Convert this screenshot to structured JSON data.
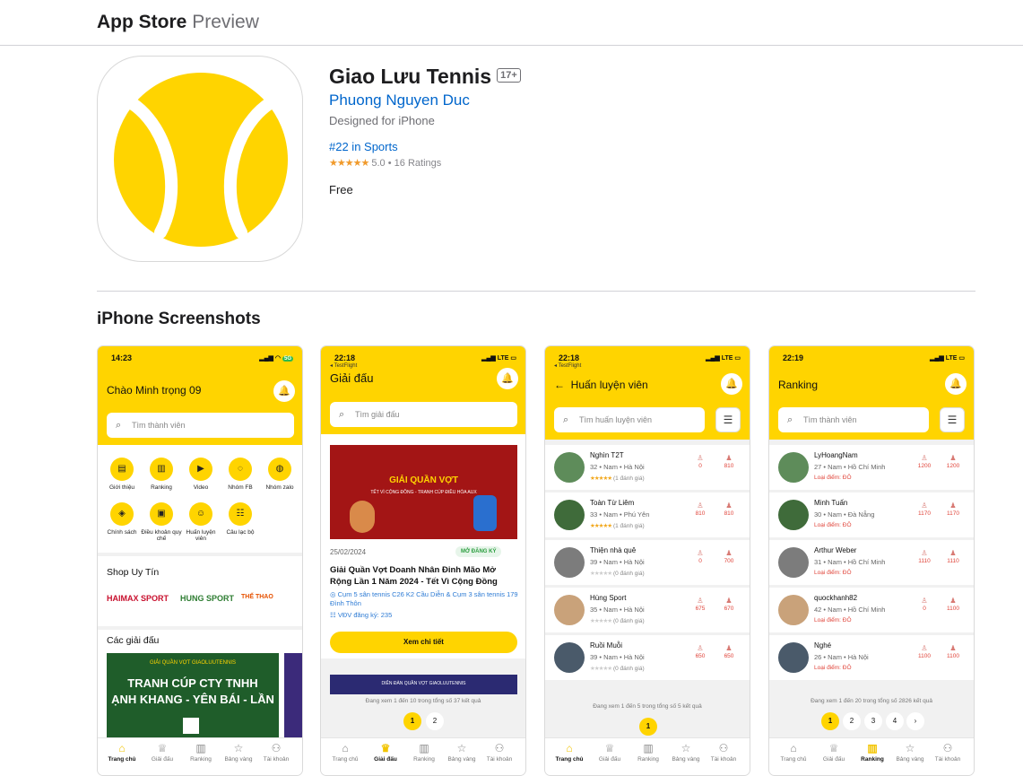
{
  "header": {
    "brand": "App Store",
    "brand_suffix": "Preview"
  },
  "app": {
    "title": "Giao Lưu Tennis",
    "age_rating": "17+",
    "developer": "Phuong Nguyen Duc",
    "designed_for": "Designed for iPhone",
    "rank": "#22 in Sports",
    "stars": "★★★★★",
    "rating_value": "5.0",
    "rating_sep": "•",
    "rating_count": "16 Ratings",
    "price": "Free",
    "icon_color": "#ffd400"
  },
  "screenshots_title": "iPhone Screenshots",
  "tabs": [
    "Trang chủ",
    "Giải đấu",
    "Ranking",
    "Bảng vàng",
    "Tài khoản"
  ],
  "screen1": {
    "time": "14:23",
    "greeting": "Chào Minh trọng 09",
    "search_placeholder": "Tìm thành viên",
    "quick_actions": [
      "Giới thiệu",
      "Ranking",
      "Video",
      "Nhóm FB",
      "Nhóm zalo",
      "Chính sách",
      "Điều khoản quy chế",
      "Huấn luyện viên",
      "Câu lạc bộ"
    ],
    "shop_title": "Shop Uy Tín",
    "sponsors": [
      "HAIMAX SPORT",
      "HUNG SPORT",
      "THẾ THAO"
    ],
    "tournaments_title": "Các giải đấu",
    "banner_top": "GIẢI QUẦN VỢT GIAOLUUTENNIS",
    "banner_line1": "TRANH CÚP CTY TNHH",
    "banner_line2": "ẠNH KHANG - YÊN BÁI - LẦN",
    "network": "5G"
  },
  "screen2": {
    "time": "22:18",
    "testflight": "◂ TestFlight",
    "title": "Giải đấu",
    "search_placeholder": "Tìm giải đấu",
    "banner_title": "GIẢI QUẦN VỢT",
    "banner_sub": "TẾT VÌ CỘNG ĐỒNG - TRANH CÚP ĐIỀU HÒA AUX",
    "date": "25/02/2024",
    "status": "MỞ ĐĂNG KÝ",
    "name": "Giải Quần Vợt Doanh Nhân Đinh Mão Mở Rộng Lần 1 Năm 2024 - Tết Vì Cộng Đồng",
    "location": "Cụm 5 sân tennis C26 K2 Cầu Diễn & Cụm 3 sân tennis 179 Đình Thôn",
    "registered": "VĐV đăng ký: 235",
    "detail_button": "Xem chi tiết",
    "next_banner": "DIỄN ĐÀN QUẦN VỢT GIAOLUUTENNIS",
    "pager_text": "Đang xem 1 đến 10 trong tổng số 37 kết quả",
    "pages": [
      "1",
      "2"
    ],
    "network": "LTE"
  },
  "screen3": {
    "time": "22:18",
    "testflight": "◂ TestFlight",
    "title": "Huấn luyện viên",
    "search_placeholder": "Tìm huấn luyện viên",
    "rows": [
      {
        "name": "Nghìn T2T",
        "meta": "32 • Nam • Hà Nội",
        "reviews": "(1 đánh giá)",
        "s1": "0",
        "s2": "810",
        "filled": true
      },
      {
        "name": "Toàn Từ Liêm",
        "meta": "33 • Nam • Phú Yên",
        "reviews": "(1 đánh giá)",
        "s1": "810",
        "s2": "810",
        "filled": true
      },
      {
        "name": "Thiện nhà quê",
        "meta": "39 • Nam • Hà Nội",
        "reviews": "(0 đánh giá)",
        "s1": "0",
        "s2": "700",
        "filled": false
      },
      {
        "name": "Hùng Sport",
        "meta": "35 • Nam • Hà Nội",
        "reviews": "(0 đánh giá)",
        "s1": "675",
        "s2": "670",
        "filled": false
      },
      {
        "name": "Ruồi Muỗi",
        "meta": "39 • Nam • Hà Nội",
        "reviews": "(0 đánh giá)",
        "s1": "650",
        "s2": "650",
        "filled": false
      }
    ],
    "pager_text": "Đang xem 1 đến 5 trong tổng số 5 kết quả",
    "pages": [
      "1"
    ],
    "network": "LTE"
  },
  "screen4": {
    "time": "22:19",
    "title": "Ranking",
    "search_placeholder": "Tìm thành viên",
    "rows": [
      {
        "name": "LyHoangNam",
        "meta": "27 • Nam • Hồ Chí Minh",
        "level": "Loại điểm: ĐÔ",
        "s1": "1200",
        "s2": "1200"
      },
      {
        "name": "Minh Tuấn",
        "meta": "30 • Nam • Đà Nẵng",
        "level": "Loại điểm: ĐÔ",
        "s1": "1170",
        "s2": "1170"
      },
      {
        "name": "Arthur Weber",
        "meta": "31 • Nam • Hồ Chí Minh",
        "level": "Loại điểm: ĐÔ",
        "s1": "1110",
        "s2": "1110"
      },
      {
        "name": "quockhanh82",
        "meta": "42 • Nam • Hồ Chí Minh",
        "level": "Loại điểm: ĐÔ",
        "s1": "0",
        "s2": "1100"
      },
      {
        "name": "Nghé",
        "meta": "26 • Nam • Hà Nội",
        "level": "Loại điểm: ĐÔ",
        "s1": "1100",
        "s2": "1100"
      }
    ],
    "pager_text": "Đang xem 1 đến 20 trong tổng số 2826 kết quả",
    "pages": [
      "1",
      "2",
      "3",
      "4"
    ],
    "next": "›",
    "network": "LTE"
  }
}
